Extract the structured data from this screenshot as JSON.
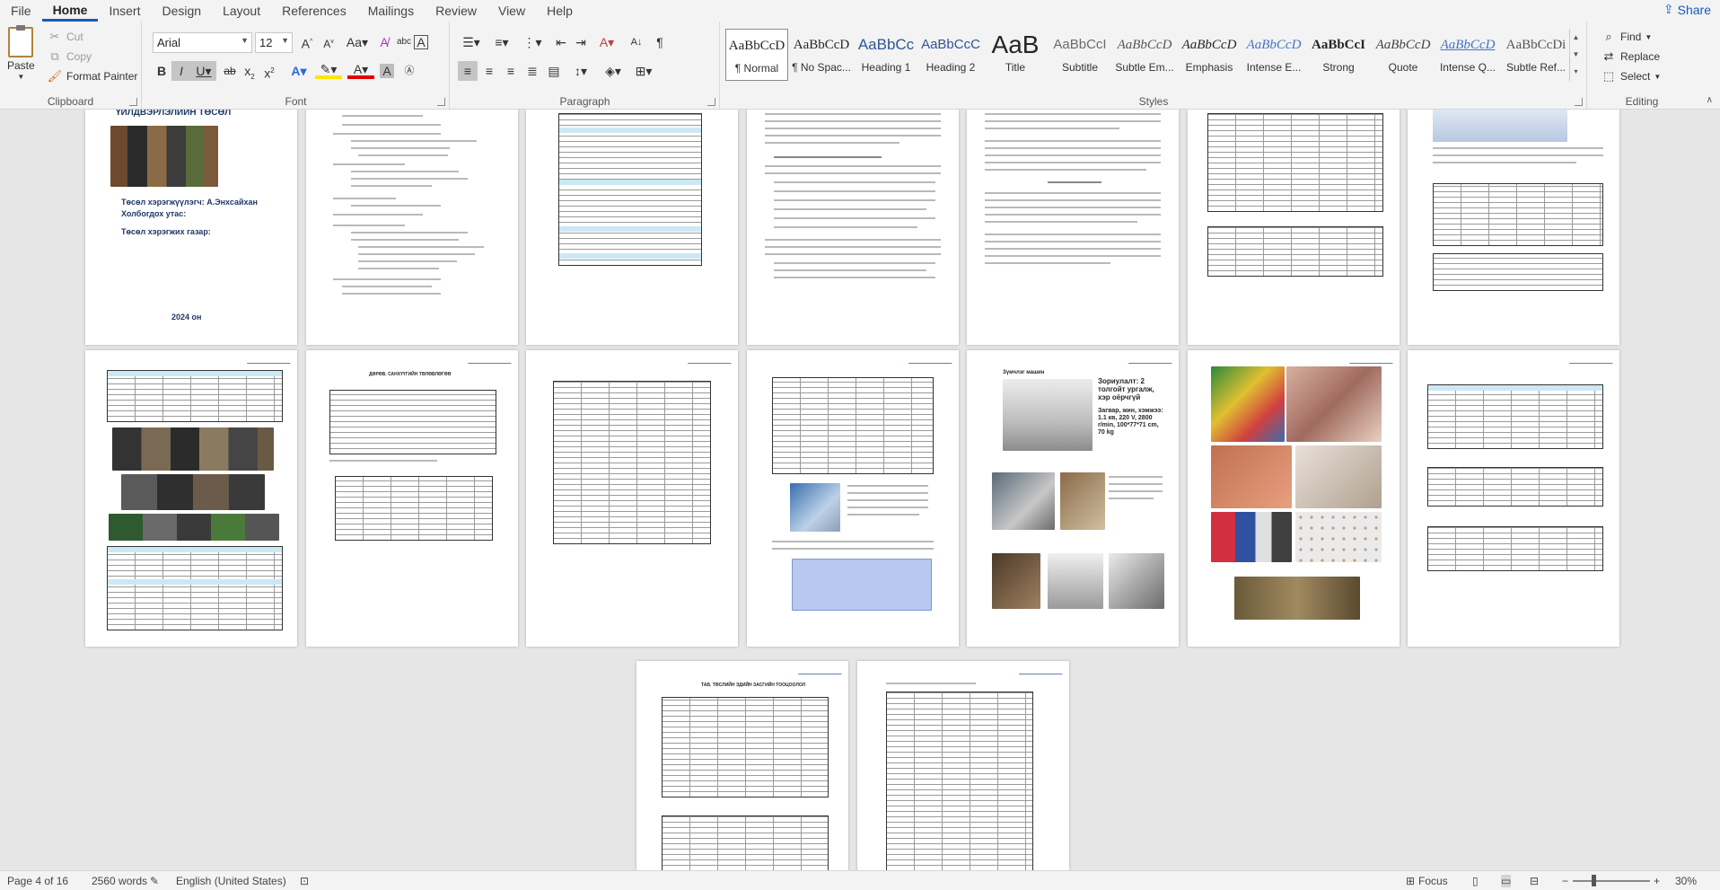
{
  "tabs": [
    "File",
    "Home",
    "Insert",
    "Design",
    "Layout",
    "References",
    "Mailings",
    "Review",
    "View",
    "Help"
  ],
  "share_label": "Share",
  "clipboard": {
    "paste": "Paste",
    "cut": "Cut",
    "copy": "Copy",
    "format_painter": "Format Painter",
    "label": "Clipboard"
  },
  "font": {
    "name": "Arial",
    "size": "12",
    "label": "Font"
  },
  "paragraph": {
    "label": "Paragraph"
  },
  "styles": {
    "label": "Styles",
    "items": [
      {
        "sample": "AaBbCcD",
        "name": "¶ Normal"
      },
      {
        "sample": "AaBbCcD",
        "name": "¶ No Spac..."
      },
      {
        "sample": "AaBbCc",
        "name": "Heading 1"
      },
      {
        "sample": "AaBbCcC",
        "name": "Heading 2"
      },
      {
        "sample": "AaB",
        "name": "Title"
      },
      {
        "sample": "AaBbCcI",
        "name": "Subtitle"
      },
      {
        "sample": "AaBbCcD",
        "name": "Subtle Em..."
      },
      {
        "sample": "AaBbCcD",
        "name": "Emphasis"
      },
      {
        "sample": "AaBbCcD",
        "name": "Intense E..."
      },
      {
        "sample": "AaBbCcI",
        "name": "Strong"
      },
      {
        "sample": "AaBbCcD",
        "name": "Quote"
      },
      {
        "sample": "AaBbCcD",
        "name": "Intense Q..."
      },
      {
        "sample": "AaBbCcDi",
        "name": "Subtle Ref..."
      }
    ]
  },
  "editing": {
    "find": "Find",
    "replace": "Replace",
    "select": "Select",
    "label": "Editing"
  },
  "pages": {
    "p1_title": "ҮЙЛДВЭРЛЭЛИЙН ТӨСӨЛ",
    "p1_author": "Төсөл хэрэгжүүлэгч: А.Энхсайхан",
    "p1_phone": "Холбогдох утас:",
    "p1_place": "Төсөл хэрэгжих газар:",
    "p1_year": "2024 он",
    "p_section_costs": "ДӨРӨВ. САНХҮҮГИЙН ТӨЛӨВЛӨГӨӨ",
    "p_section_calc": "ТАВ. ТӨСЛИЙН ЭДИЙН ЗАСГИЙН ТООЦООЛОЛ",
    "p_machine1_title": "Зүмчлэг машин",
    "p_machine1_desc": "Зориулалт: 2 толгойт ургалж, хэр оёрчгүй",
    "p_machine1_spec": "Загвар, жин, хэмжээ: 1.1 кв, 220 V, 2800 r/min, 100*77*71 cm, 70 kg"
  },
  "status": {
    "page": "Page 4 of 16",
    "words": "2560 words",
    "language": "English (United States)",
    "focus": "Focus",
    "zoom": "30%"
  }
}
